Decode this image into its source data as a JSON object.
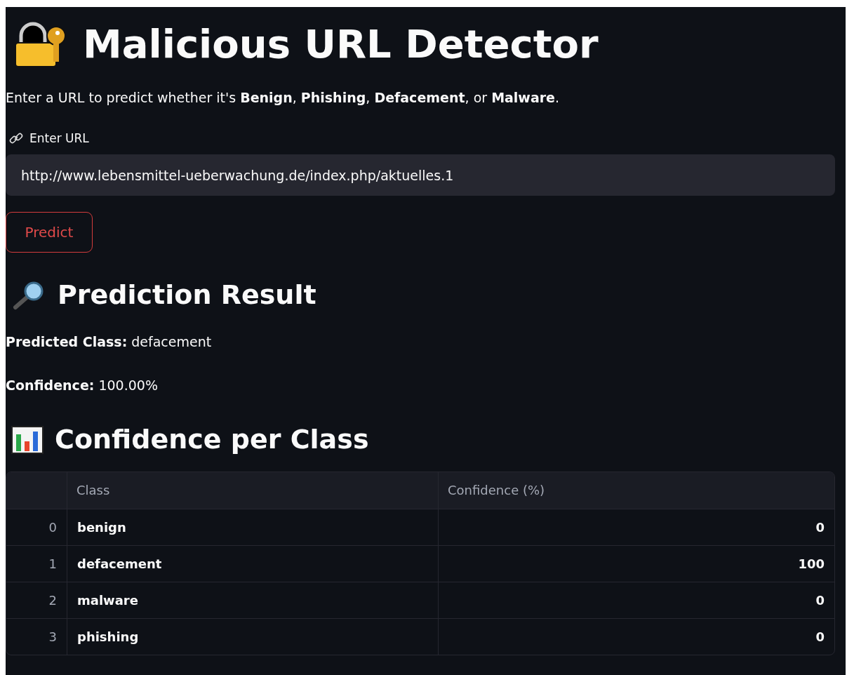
{
  "title": "Malicious URL Detector",
  "intro": "Enter a URL to predict whether it's **Benign**, **Phishing**, **Defacement**, or **Malware**.",
  "url_field": {
    "label": "Enter URL",
    "value": "http://www.lebensmittel-ueberwachung.de/index.php/aktuelles.1"
  },
  "predict_button": "Predict",
  "result": {
    "heading": "Prediction Result",
    "predicted_class": "**Predicted Class:** defacement",
    "confidence": "**Confidence:** 100.00%"
  },
  "table": {
    "heading": "Confidence per Class",
    "columns": [
      "Class",
      "Confidence (%)"
    ],
    "rows": [
      {
        "index": "0",
        "class": "benign",
        "confidence": "0"
      },
      {
        "index": "1",
        "class": "defacement",
        "confidence": "100"
      },
      {
        "index": "2",
        "class": "malware",
        "confidence": "0"
      },
      {
        "index": "3",
        "class": "phishing",
        "confidence": "0"
      }
    ]
  }
}
